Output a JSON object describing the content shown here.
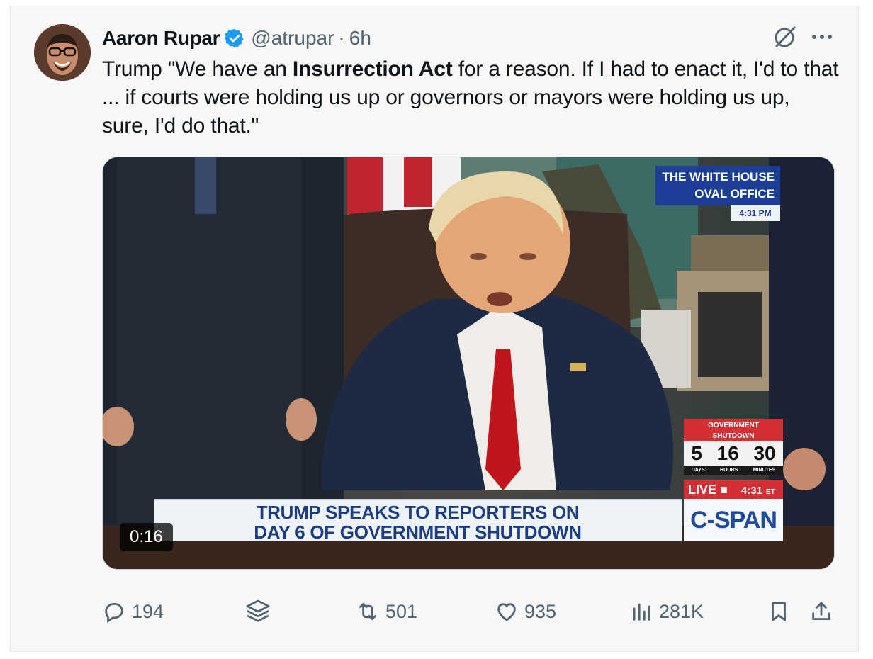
{
  "author": {
    "name": "Aaron Rupar",
    "handle": "@atrupar",
    "separator": "·",
    "time": "6h",
    "verified_color": "#1d9bf0"
  },
  "tweet": {
    "text_before": "Trump \"We have an ",
    "text_bold": "Insurrection Act",
    "text_after": " for a reason. If I had to enact it, I'd to that ... if courts were holding us up or governors or mayors were holding us up, sure, I'd do that.\""
  },
  "video": {
    "duration": "0:16",
    "chyron_line1": "TRUMP SPEAKS TO REPORTERS ON",
    "chyron_line2": "DAY 6 OF GOVERNMENT SHUTDOWN",
    "network": "C-SPAN",
    "live_label": "LIVE ■",
    "live_time": "4:31",
    "live_tz": "ET",
    "location_line1": "THE WHITE HOUSE",
    "location_line2": "OVAL OFFICE",
    "location_time": "4:31 PM",
    "shutdown_title_line1": "GOVERNMENT",
    "shutdown_title_line2": "SHUTDOWN",
    "shutdown_days": "5",
    "shutdown_hours": "16",
    "shutdown_minutes": "30",
    "unit_days": "DAYS",
    "unit_hours": "HOURS",
    "unit_minutes": "MINUTES"
  },
  "actions": {
    "replies": "194",
    "reposts": "501",
    "likes": "935",
    "views": "281K"
  },
  "icons": [
    "grok-icon",
    "more-icon",
    "reply-icon",
    "stack-icon",
    "repost-icon",
    "like-icon",
    "views-icon",
    "bookmark-icon",
    "share-icon"
  ],
  "colors": {
    "secondary_text": "#536471",
    "chyron_text": "#1d3d82",
    "cspan_red": "#d32f35",
    "cspan_blue": "#1c3e96"
  }
}
